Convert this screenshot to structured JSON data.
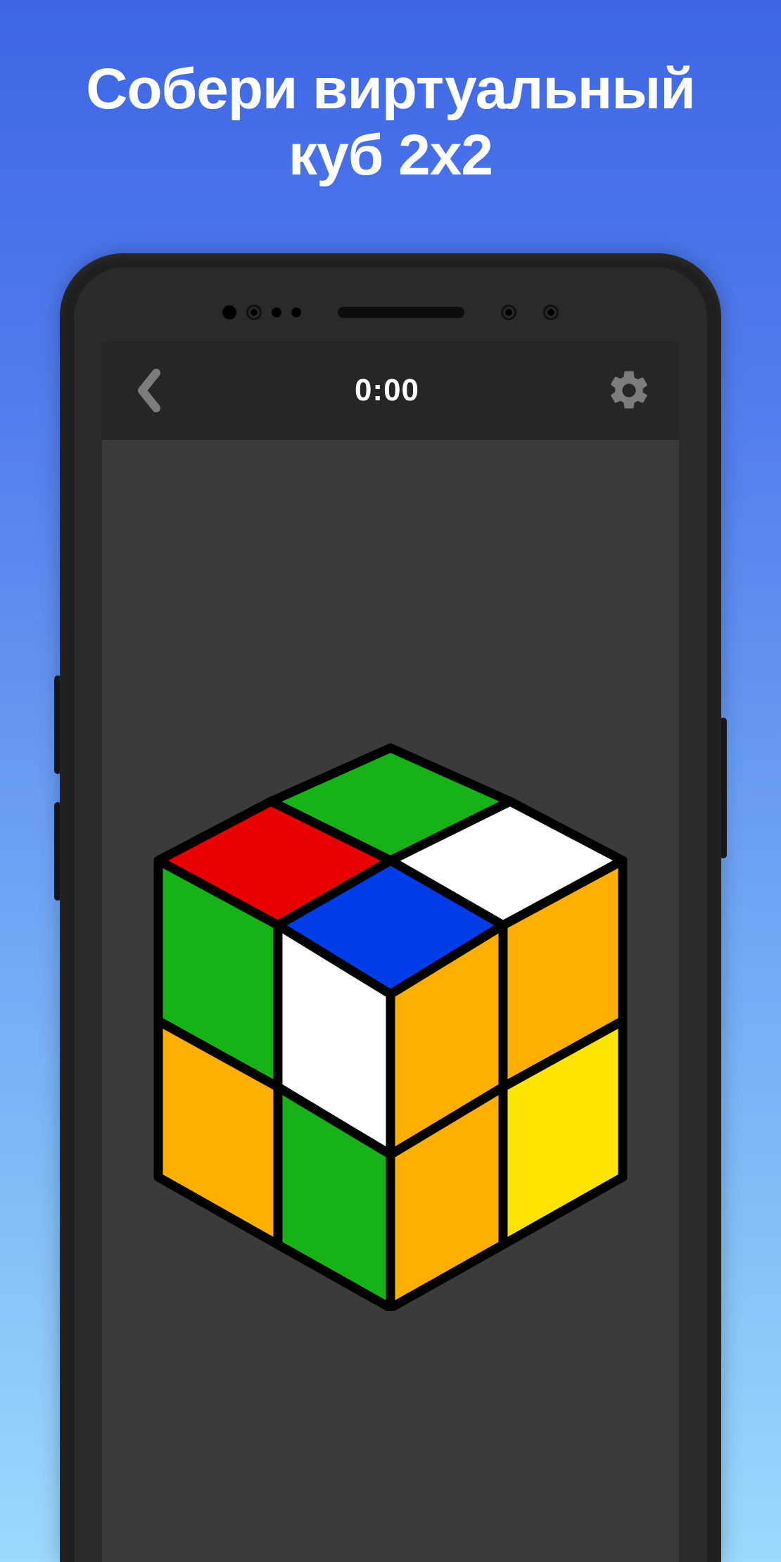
{
  "promo": {
    "headline_line1": "Собери виртуальный",
    "headline_line2": "куб 2x2"
  },
  "app": {
    "timer": "0:00"
  },
  "cube": {
    "type": "2x2",
    "top": {
      "back_left": "#17B217",
      "back_right": "#FFFFFF",
      "front_left": "#E80000",
      "front_right": "#003CE8"
    },
    "front": {
      "top_left": "#17B217",
      "top_right": "#FFFFFF",
      "bottom_left": "#FFAF00",
      "bottom_right": "#17B217"
    },
    "right": {
      "top_left": "#FFAF00",
      "top_right": "#FFAF00",
      "bottom_left": "#FFAF00",
      "bottom_right": "#FCE300"
    },
    "outline": "#000000"
  },
  "colors": {
    "bg_top": "#3e66e6",
    "bg_bottom": "#9cd9fc",
    "phone_body": "#1f1f1f",
    "screen_bg": "#3b3b3b",
    "topbar_bg": "#262626",
    "icon_gray": "#7d7d7d"
  }
}
